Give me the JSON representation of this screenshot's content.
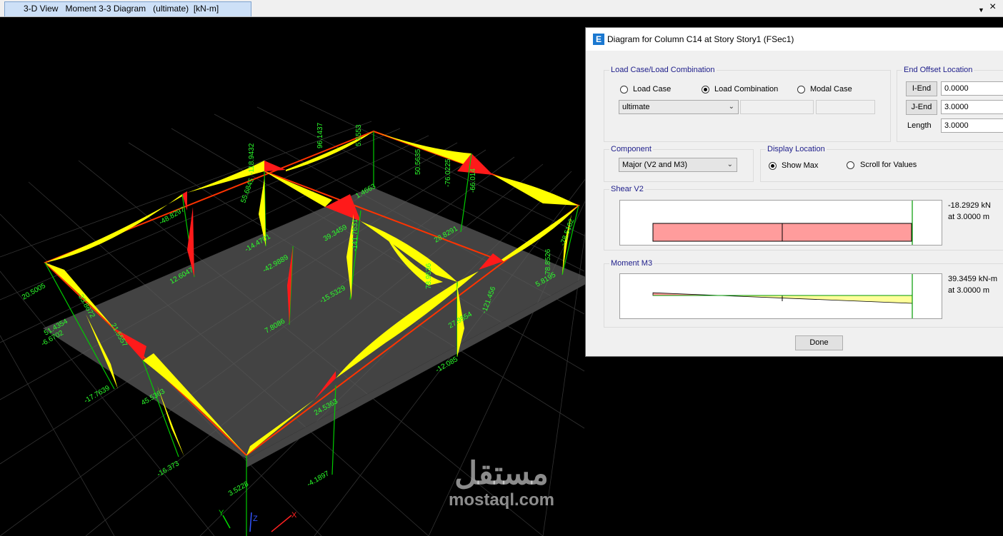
{
  "tab": {
    "title": "3-D View   Moment 3-3 Diagram   (ultimate)  [kN-m]",
    "dropdown_glyph": "▼",
    "close_glyph": "×"
  },
  "viewport": {
    "labels": [
      "-118.9432",
      "96.1437",
      "5.5553",
      "50.5635",
      "-76.0225",
      "-66.014",
      "-48.8297",
      "55.6845",
      "1.4663",
      "-14.4701",
      "12.6047",
      "39.3459",
      "-141.7631",
      "28.8291",
      "-78.5182",
      "78.8526",
      "5.8195",
      "-42.9889",
      "7.8086",
      "-15.5329",
      "78.9536",
      "27.9554",
      "-121.456",
      "-12.085",
      "20.5005",
      "-33.8672",
      "51.4354",
      "21.5557",
      "-6.6702",
      "-17.7639",
      "45.5363",
      "-16.373",
      "24.5363",
      "-4.1897",
      "3.5228"
    ],
    "axes": {
      "x": "X",
      "y": "Y",
      "z": "Z"
    },
    "colors": {
      "positive": "#ffff00",
      "negative": "#ff1a1a",
      "frame": "#ff2a00",
      "column": "#00cc00",
      "label": "#2bff2b"
    }
  },
  "dialog": {
    "title": "Diagram for Column C14 at Story Story1 (FSec1)",
    "icon": "E",
    "load_group": {
      "title": "Load Case/Load Combination",
      "options": [
        "Load Case",
        "Load Combination",
        "Modal Case"
      ],
      "selected": "Load Combination",
      "combo_value": "ultimate"
    },
    "offset_group": {
      "title": "End Offset Location",
      "i_end_label": "I-End",
      "i_end_value": "0.0000",
      "j_end_label": "J-End",
      "j_end_value": "3.0000",
      "length_label": "Length",
      "length_value": "3.0000"
    },
    "component_group": {
      "title": "Component",
      "combo_value": "Major (V2 and M3)"
    },
    "display_group": {
      "title": "Display Location",
      "options": [
        "Show Max",
        "Scroll for Values"
      ],
      "selected": "Show Max"
    },
    "shear": {
      "title": "Shear V2",
      "value_text": "-18.2929 kN",
      "location_text": "at 3.0000 m",
      "value": -18.2929,
      "location": 3.0
    },
    "moment": {
      "title": "Moment M3",
      "value_text": "39.3459 kN-m",
      "location_text": "at 3.0000 m",
      "start": -13.67,
      "end": 39.3459,
      "length": 3.0
    },
    "done_label": "Done"
  },
  "watermark": {
    "arabic": "مستقل",
    "latin": "mostaql.com"
  }
}
